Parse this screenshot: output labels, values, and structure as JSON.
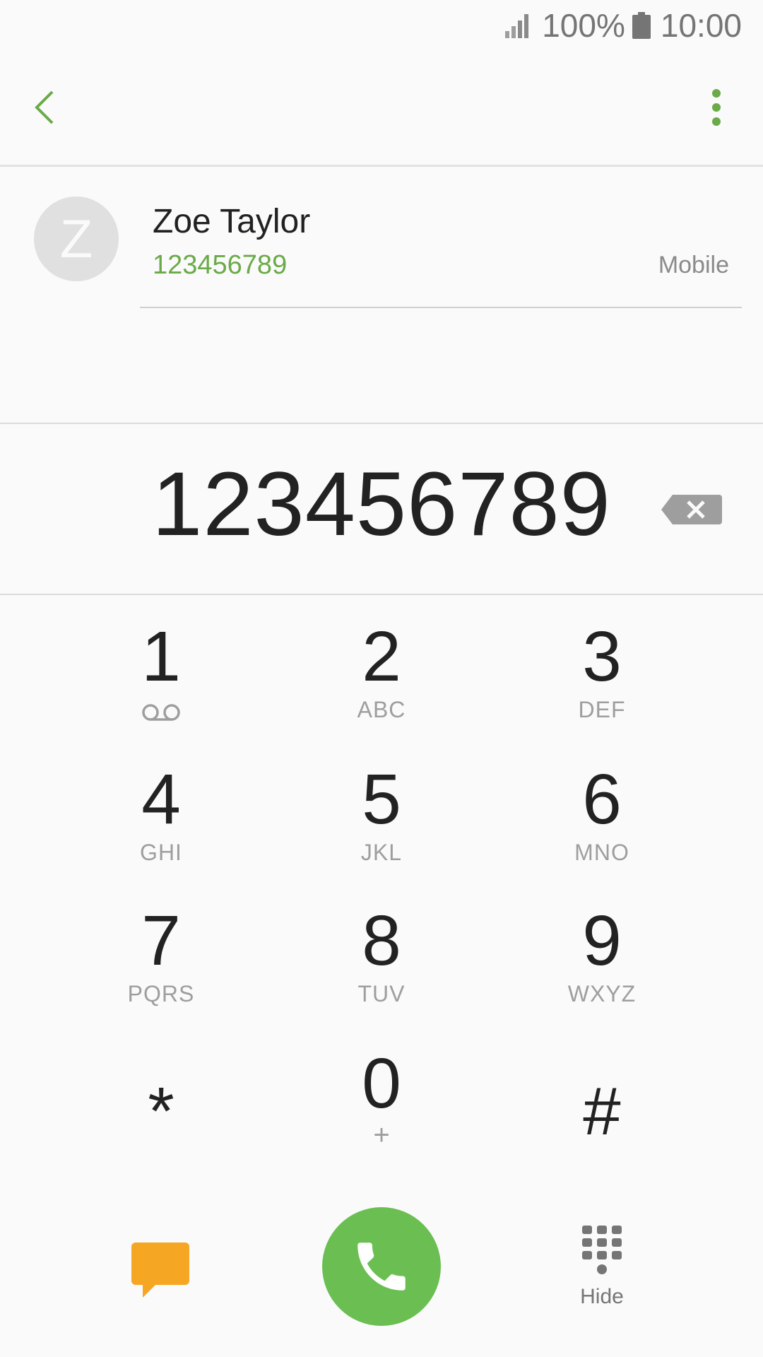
{
  "status_bar": {
    "battery_percent": "100%",
    "time": "10:00",
    "icons": [
      "signal-icon",
      "battery-icon"
    ]
  },
  "app_bar": {
    "icons": [
      "back-arrow-icon",
      "more-options-icon"
    ],
    "accent_color": "#6aaa48"
  },
  "contact": {
    "initial": "Z",
    "name": "Zoe Taylor",
    "number": "123456789",
    "type": "Mobile"
  },
  "dialer": {
    "entered_number": "123456789",
    "backspace_icon": "backspace-icon"
  },
  "keypad": {
    "keys": [
      {
        "digit": "1",
        "letters": ""
      },
      {
        "digit": "2",
        "letters": "ABC"
      },
      {
        "digit": "3",
        "letters": "DEF"
      },
      {
        "digit": "4",
        "letters": "GHI"
      },
      {
        "digit": "5",
        "letters": "JKL"
      },
      {
        "digit": "6",
        "letters": "MNO"
      },
      {
        "digit": "7",
        "letters": "PQRS"
      },
      {
        "digit": "8",
        "letters": "TUV"
      },
      {
        "digit": "9",
        "letters": "WXYZ"
      },
      {
        "digit": "*",
        "letters": ""
      },
      {
        "digit": "0",
        "letters": "+"
      },
      {
        "digit": "#",
        "letters": ""
      }
    ]
  },
  "actions": {
    "message_icon": "message-icon",
    "message_color": "#f5a623",
    "call_icon": "phone-icon",
    "call_color": "#6bbf52",
    "hide_label": "Hide",
    "hide_icon": "dialpad-icon"
  }
}
